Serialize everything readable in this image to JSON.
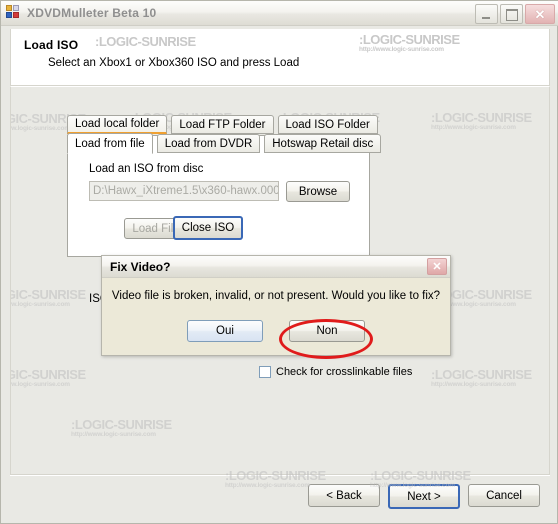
{
  "window": {
    "title": "XDVDMulleter Beta 10",
    "icon": "app-window-icon",
    "minimize_label": "–",
    "maximize_label": "□",
    "close_label": "✕"
  },
  "wizard": {
    "title": "Load ISO",
    "subtitle": "Select an Xbox1 or Xbox360 ISO and press Load"
  },
  "tabs": {
    "top_row": [
      {
        "label": "Load local folder",
        "selected": true
      },
      {
        "label": "Load FTP Folder",
        "selected": false
      },
      {
        "label": "Load ISO Folder",
        "selected": false
      }
    ],
    "sub_row": [
      {
        "label": "Load from file",
        "selected": true
      },
      {
        "label": "Load from DVDR",
        "selected": false
      },
      {
        "label": "Hotswap Retail disc",
        "selected": false
      }
    ]
  },
  "panel": {
    "group_label": "Load an ISO from disc",
    "path_value": "D:\\Hawx_iXtreme1.5\\x360-hawx.000",
    "path_placeholder": "D:\\Hawx_iXtreme1.5\\x360-hawx.000",
    "browse_label": "Browse",
    "load_file_label": "Load File",
    "close_iso_label": "Close ISO",
    "status_text": "ISO load"
  },
  "options": {
    "crosslink_label": "Check for crosslinkable files",
    "crosslink_checked": false
  },
  "footer": {
    "back_label": "< Back",
    "next_label": "Next >",
    "cancel_label": "Cancel"
  },
  "dialog": {
    "title": "Fix Video?",
    "message": "Video file is broken, invalid, or not present. Would you like to fix?",
    "yes_label": "Oui",
    "no_label": "Non",
    "close_label": "✕",
    "annotation_color": "#e01b1b",
    "annotated_button": "Non"
  },
  "watermark": {
    "line1": ":LOGIC-SUNRISE",
    "line2": "http://www.logic-sunrise.com"
  }
}
